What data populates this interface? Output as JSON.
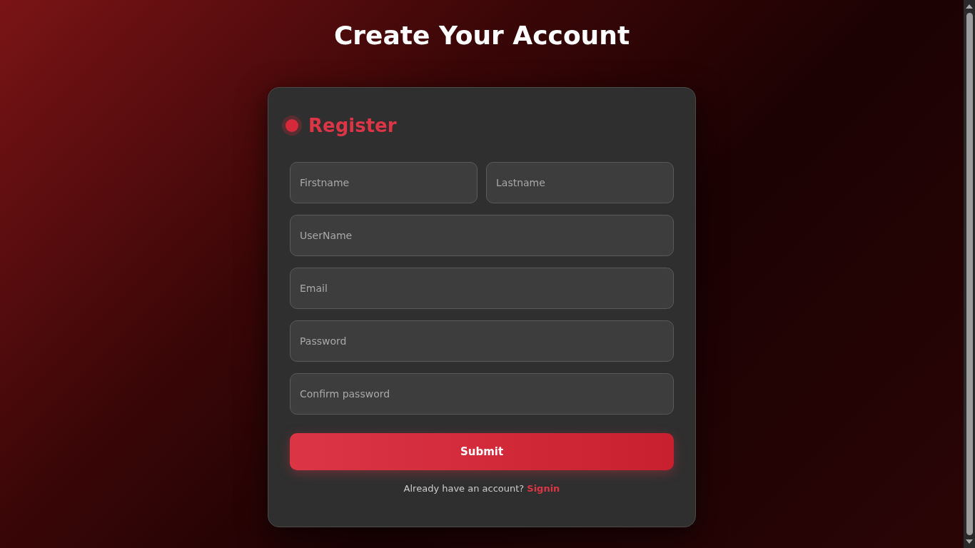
{
  "page_title": "Create Your Account",
  "form": {
    "title": "Register",
    "rows": [
      [
        {
          "placeholder": "Firstname"
        },
        {
          "placeholder": "Lastname"
        }
      ],
      [
        {
          "placeholder": "UserName"
        }
      ],
      [
        {
          "placeholder": "Email"
        }
      ],
      [
        {
          "placeholder": "Password"
        }
      ],
      [
        {
          "placeholder": "Confirm password"
        }
      ]
    ],
    "submit": "Submit",
    "footer_text": "Already have an account?",
    "footer_link": "Signin"
  }
}
